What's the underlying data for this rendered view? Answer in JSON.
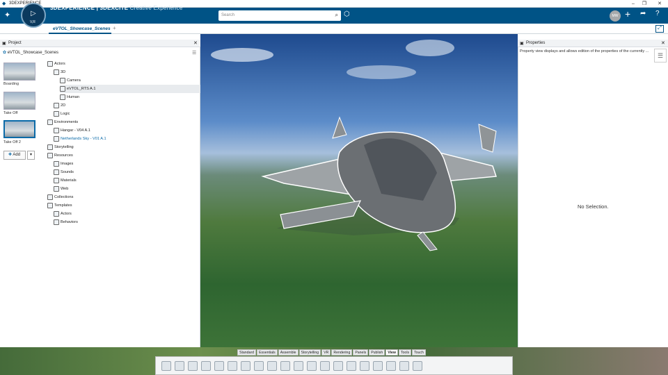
{
  "window": {
    "title": "3DEXPERIENCE"
  },
  "header": {
    "brand_bold": "3DEXPERIENCE | 3DEXCITE",
    "brand_light": "Creative Experience",
    "compass_label": "V,R",
    "search_placeholder": "Search",
    "avatar_initials": "MW"
  },
  "tabs": [
    {
      "label": "eVTOL_Showcase_Scenes"
    }
  ],
  "left_panel": {
    "title": "Project",
    "root": "eVTOL_Showcase_Scenes",
    "scenes": [
      "Boarding",
      "Take Off",
      "Take Off 2"
    ],
    "add_label": "Add",
    "tree": [
      {
        "label": "Actors",
        "depth": 0
      },
      {
        "label": "3D",
        "depth": 1
      },
      {
        "label": "Camera",
        "depth": 2
      },
      {
        "label": "eVTOL_RTS A.1",
        "depth": 2
      },
      {
        "label": "Human",
        "depth": 2
      },
      {
        "label": "2D",
        "depth": 1
      },
      {
        "label": "Logic",
        "depth": 1
      },
      {
        "label": "Environments",
        "depth": 0
      },
      {
        "label": "Hangar - V04 A.1",
        "depth": 1
      },
      {
        "label": "Netherlands Sky - V01 A.1",
        "depth": 1
      },
      {
        "label": "Storytelling",
        "depth": 0
      },
      {
        "label": "Resources",
        "depth": 0
      },
      {
        "label": "Images",
        "depth": 1
      },
      {
        "label": "Sounds",
        "depth": 1
      },
      {
        "label": "Materials",
        "depth": 1
      },
      {
        "label": "Web",
        "depth": 1
      },
      {
        "label": "Collections",
        "depth": 0
      },
      {
        "label": "Templates",
        "depth": 0
      },
      {
        "label": "Actors",
        "depth": 1
      },
      {
        "label": "Behaviors",
        "depth": 1
      }
    ]
  },
  "right_panel": {
    "title": "Properties",
    "description": "Property view displays and allows edition of the properties of the currently ...",
    "empty_text": "No Selection."
  },
  "bottom_tabs": [
    "Standard",
    "Essentials",
    "Assemble",
    "Storytelling",
    "VR",
    "Rendering",
    "Panels",
    "Publish",
    "View",
    "Tools",
    "Touch"
  ],
  "active_bottom_tab": "View"
}
